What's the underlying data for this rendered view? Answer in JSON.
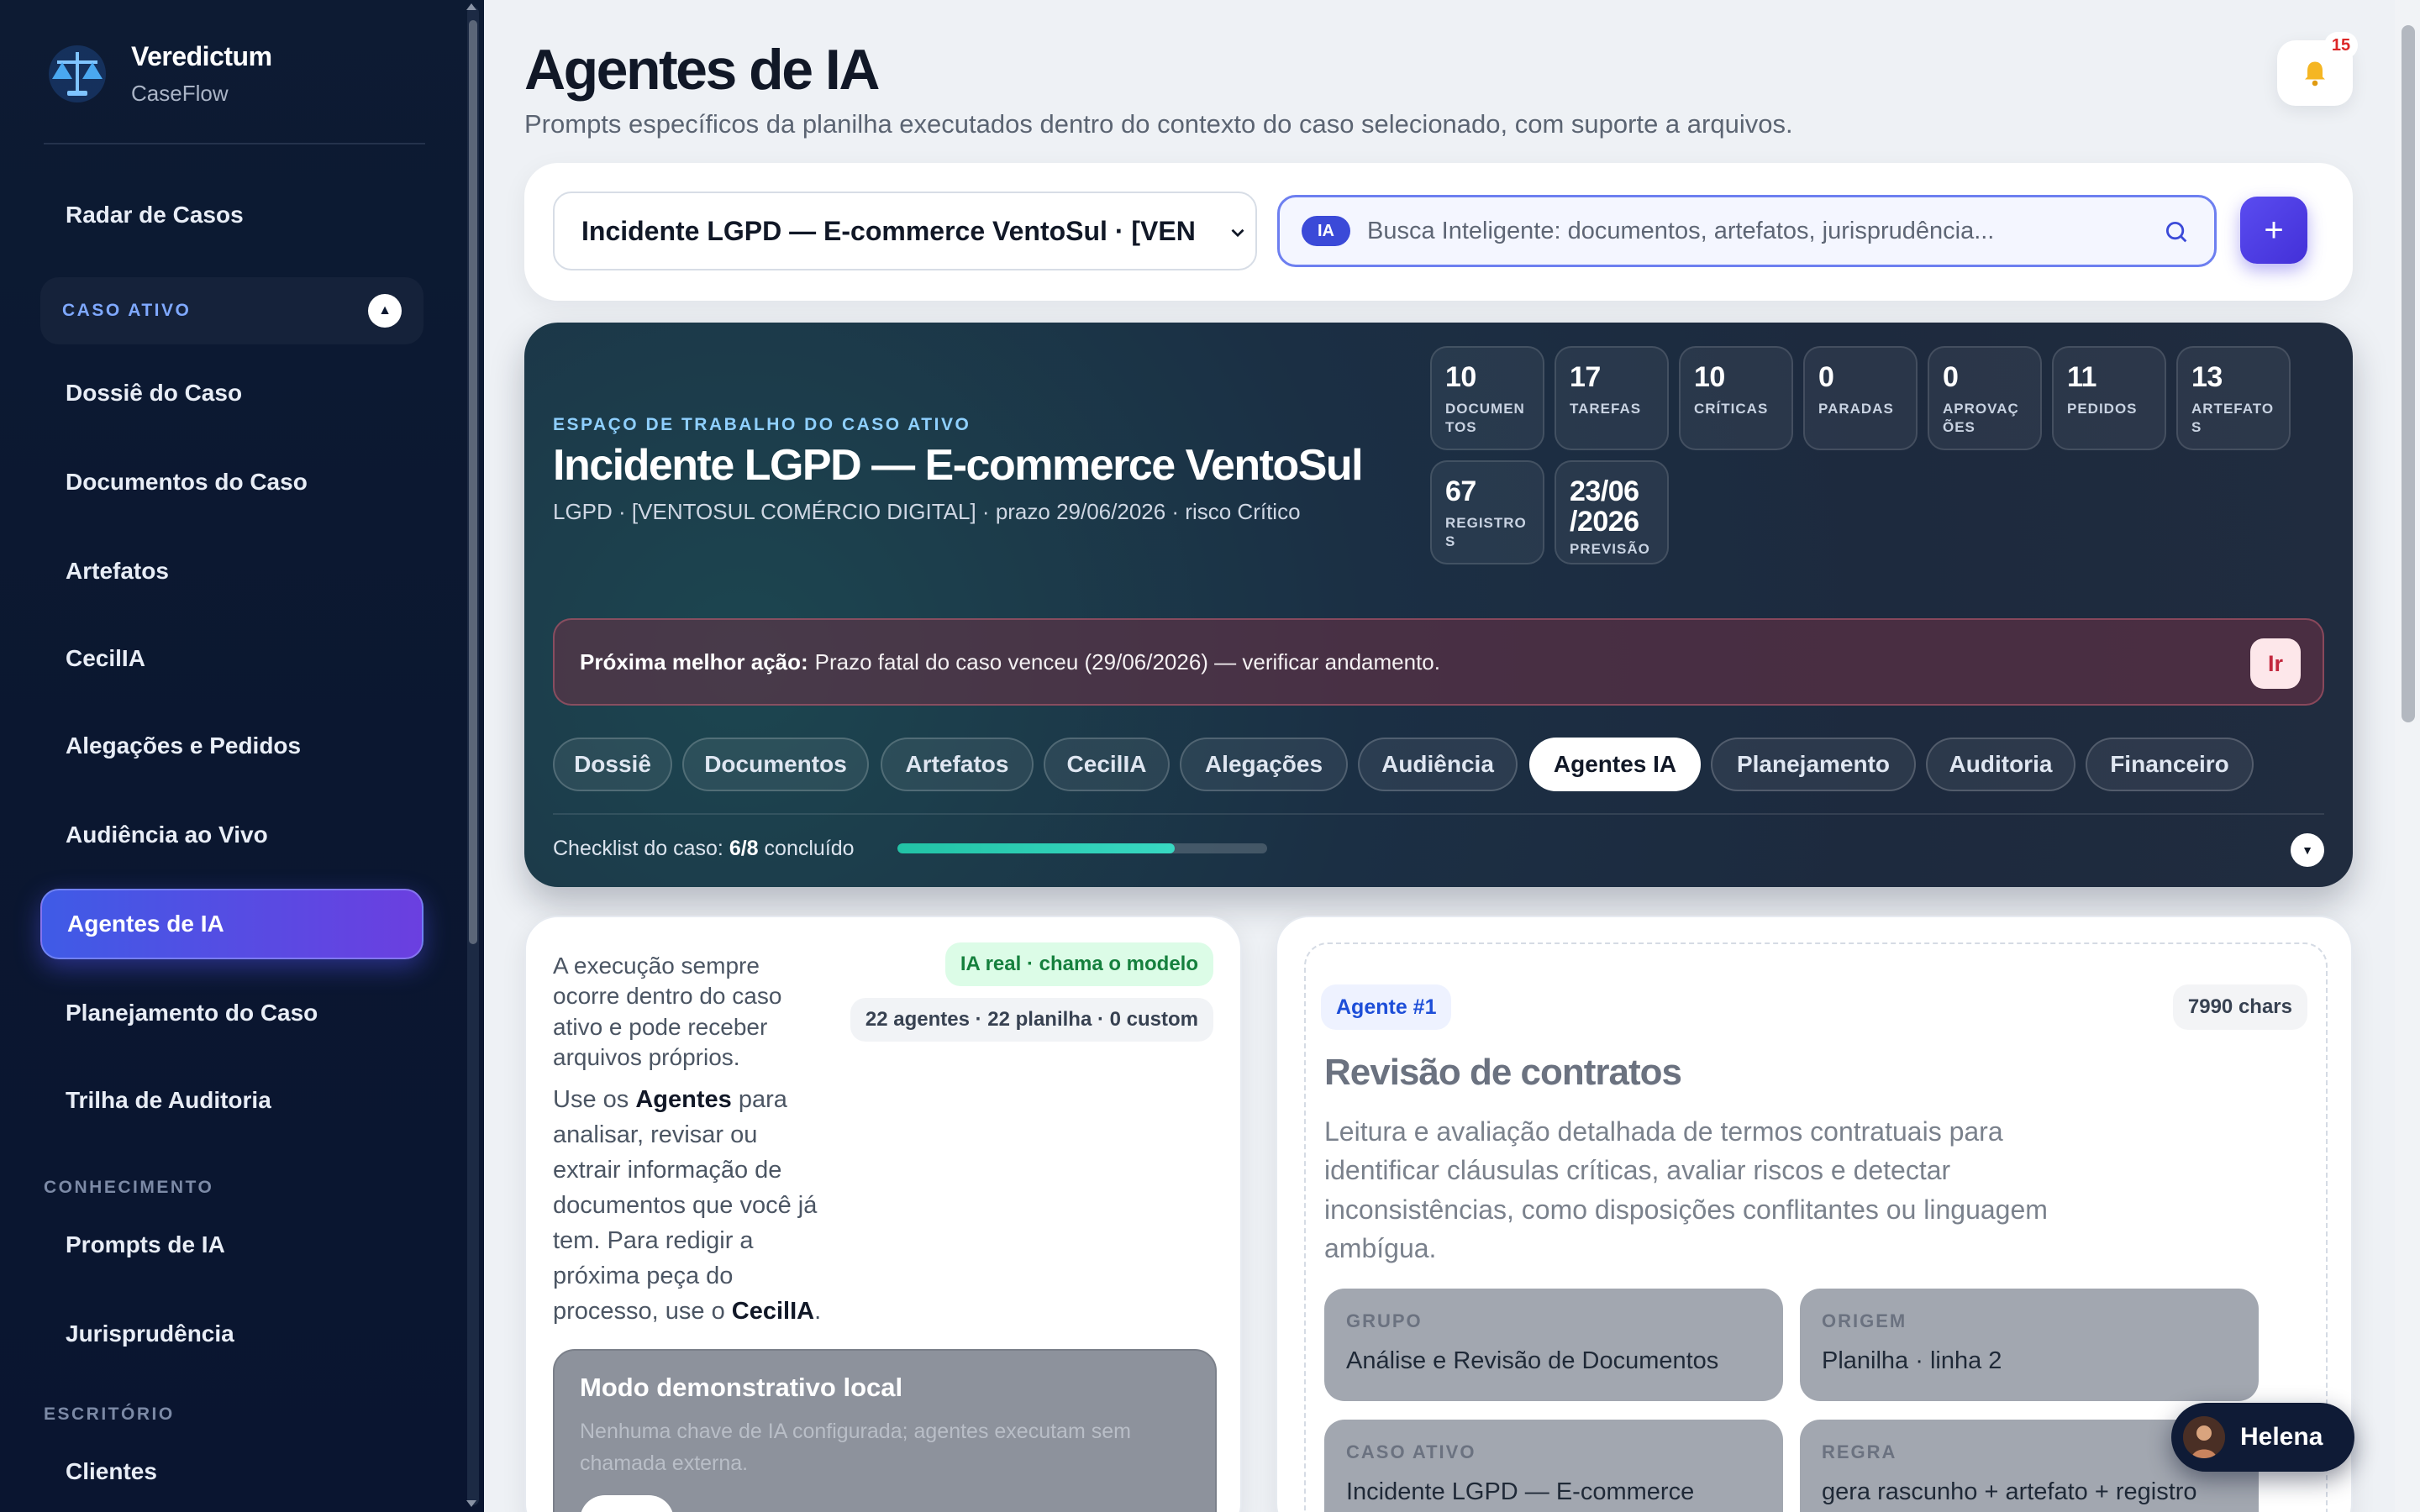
{
  "sidebar": {
    "brand_name": "Veredictum",
    "brand_sub": "CaseFlow",
    "radar": "Radar de Casos",
    "active_case_label": "CASO ATIVO",
    "case_items": [
      "Dossiê do Caso",
      "Documentos do Caso",
      "Artefatos",
      "CecilIA",
      "Alegações e Pedidos",
      "Audiência ao Vivo",
      "Agentes de IA",
      "Planejamento do Caso",
      "Trilha de Auditoria"
    ],
    "section_knowledge": "CONHECIMENTO",
    "knowledge_items": [
      "Prompts de IA",
      "Jurisprudência"
    ],
    "section_office": "ESCRITÓRIO",
    "office_items": [
      "Clientes"
    ]
  },
  "header": {
    "title": "Agentes de IA",
    "subtitle": "Prompts específicos da planilha executados dentro do contexto do caso selecionado, com suporte a arquivos.",
    "notification_count": "15"
  },
  "toolbar": {
    "case_select_value": "Incidente LGPD — E-commerce VentoSul · [VENTOSUL COMÉRCIO DIGITAL]",
    "ia_chip": "IA",
    "search_placeholder": "Busca Inteligente: documentos, artefatos, jurisprudência...",
    "add_label": "+"
  },
  "hero": {
    "eyebrow": "ESPAÇO DE TRABALHO DO CASO ATIVO",
    "title": "Incidente LGPD — E-commerce VentoSul",
    "meta": "LGPD · [VENTOSUL COMÉRCIO DIGITAL] · prazo 29/06/2026 · risco Crítico",
    "stats": [
      {
        "value": "10",
        "label": "DOCUMENTOS"
      },
      {
        "value": "17",
        "label": "TAREFAS"
      },
      {
        "value": "10",
        "label": "CRÍTICAS"
      },
      {
        "value": "0",
        "label": "PARADAS"
      },
      {
        "value": "0",
        "label": "APROVAÇÕES"
      },
      {
        "value": "11",
        "label": "PEDIDOS"
      },
      {
        "value": "13",
        "label": "ARTEFATOS"
      },
      {
        "value": "67",
        "label": "REGISTROS"
      },
      {
        "value": "23/06 /2026",
        "label": "PREVISÃO"
      }
    ],
    "next_action_label": "Próxima melhor ação:",
    "next_action_text": "Prazo fatal do caso venceu (29/06/2026) — verificar andamento.",
    "go_label": "Ir",
    "tabs": [
      "Dossiê",
      "Documentos",
      "Artefatos",
      "CecilIA",
      "Alegações",
      "Audiência",
      "Agentes IA",
      "Planejamento",
      "Auditoria",
      "Financeiro"
    ],
    "active_tab": "Agentes IA",
    "checklist_label": "Checklist do caso:",
    "checklist_value": "6/8",
    "checklist_suffix": "concluído",
    "checklist_progress": 0.75
  },
  "info_card": {
    "intro": "A execução sempre ocorre dentro do caso ativo e pode receber arquivos próprios.",
    "real_pill": "IA real · chama o modelo",
    "count_pill": "22 agentes · 22 planilha · 0 custom",
    "body_1": "Use os",
    "body_agents": "Agentes",
    "body_2": "para analisar, revisar ou extrair informação de documentos que você já tem. Para redigir a próxima peça do processo, use o",
    "body_cecilia": "CecilIA",
    "body_3": ".",
    "demo_title": "Modo demonstrativo local",
    "demo_text": "Nenhuma chave de IA configurada; agentes executam sem chamada externa."
  },
  "agent_card": {
    "badge": "Agente #1",
    "chars": "7990 chars",
    "title": "Revisão de contratos",
    "description": "Leitura e avaliação detalhada de termos contratuais para identificar cláusulas críticas, avaliar riscos e detectar inconsistências, como disposições conflitantes ou linguagem ambígua.",
    "group_label": "GRUPO",
    "group_value": "Análise e Revisão de Documentos",
    "origin_label": "ORIGEM",
    "origin_value": "Planilha · linha 2",
    "case_label": "CASO ATIVO",
    "case_value": "Incidente LGPD — E-commerce",
    "rule_label": "REGRA",
    "rule_value": "gera rascunho + artefato + registro por"
  },
  "chat": {
    "name": "Helena"
  },
  "colors": {
    "accent": "#4330d8",
    "sidebar_bg": "#0d1b33",
    "progress": "#22c3a6"
  }
}
